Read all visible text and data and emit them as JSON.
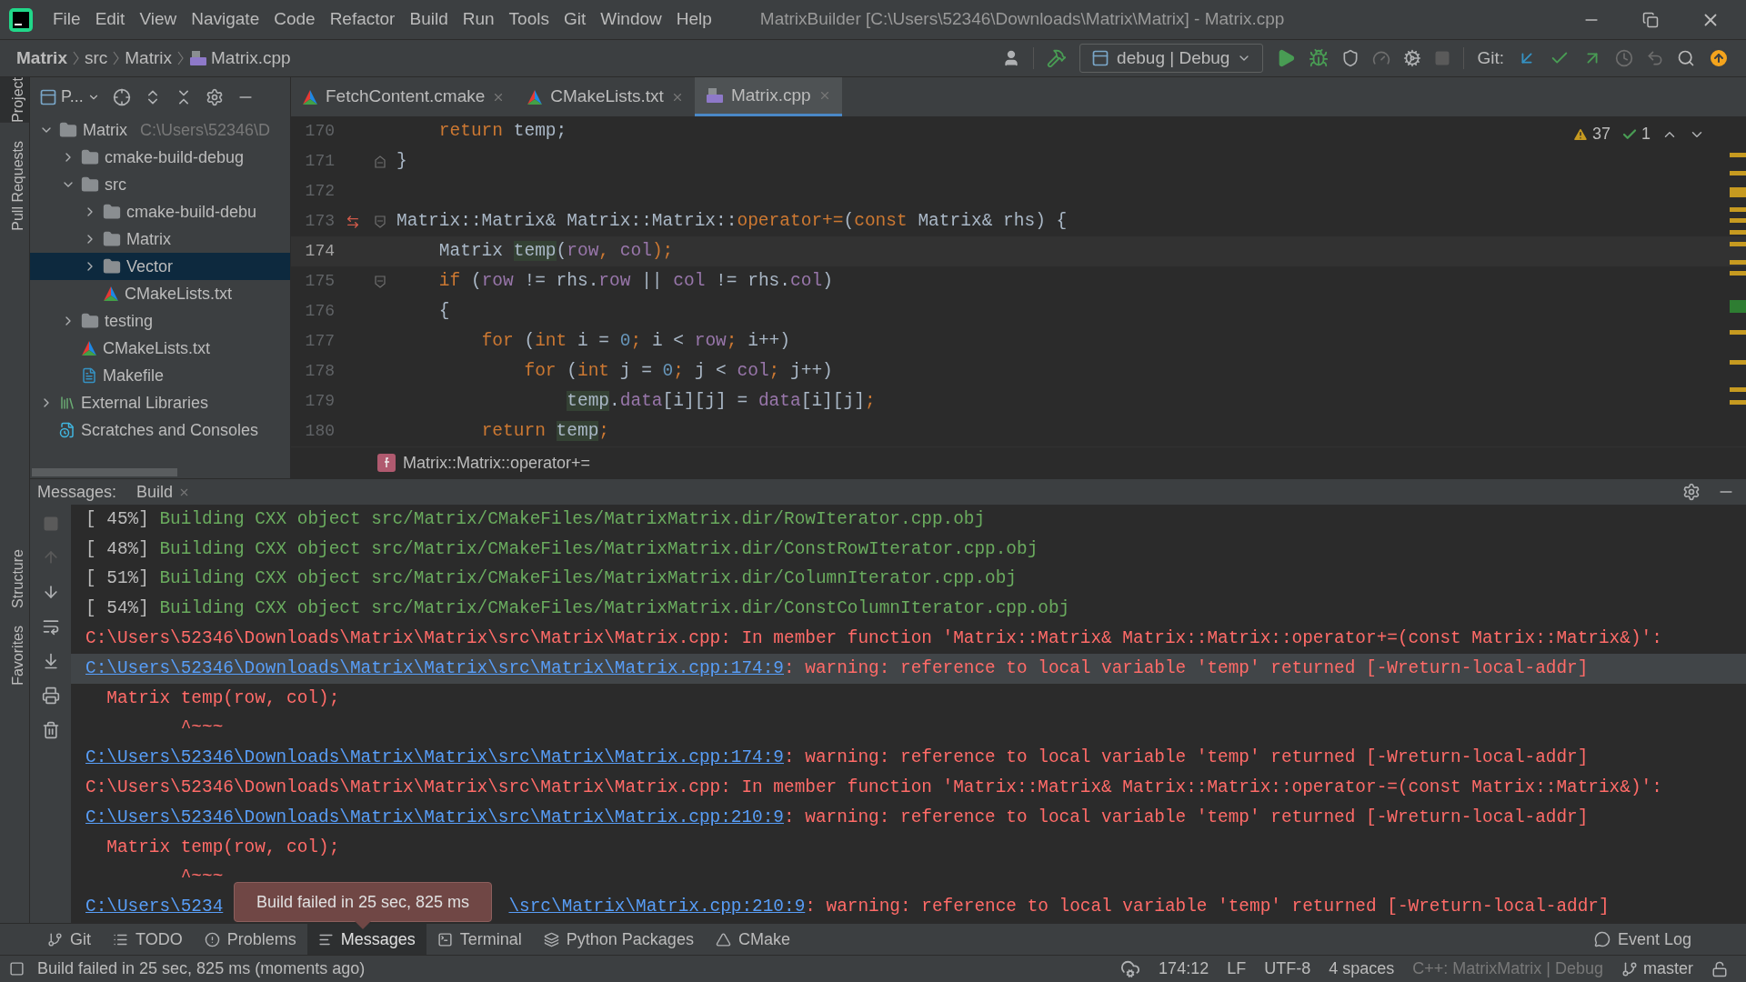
{
  "window": {
    "title": "MatrixBuilder [C:\\Users\\52346\\Downloads\\Matrix\\Matrix] - Matrix.cpp"
  },
  "menu": [
    "File",
    "Edit",
    "View",
    "Navigate",
    "Code",
    "Refactor",
    "Build",
    "Run",
    "Tools",
    "Git",
    "Window",
    "Help"
  ],
  "breadcrumb": [
    "Matrix",
    "src",
    "Matrix",
    "Matrix.cpp"
  ],
  "toolbar": {
    "configuration": "debug | Debug",
    "git_label": "Git:"
  },
  "side_tools": [
    {
      "label": "Project",
      "selected": true
    },
    {
      "label": "Pull Requests",
      "selected": false
    },
    {
      "label": "Structure",
      "selected": false
    },
    {
      "label": "Favorites",
      "selected": false
    }
  ],
  "project": {
    "title": "P...",
    "tree": [
      {
        "kind": "folder",
        "label": "Matrix",
        "path": "C:\\Users\\52346\\D",
        "expanded": true,
        "selected": false,
        "children": [
          {
            "kind": "folder",
            "label": "cmake-build-debug",
            "expanded": false,
            "selected": false
          },
          {
            "kind": "folder",
            "label": "src",
            "expanded": true,
            "selected": false,
            "children": [
              {
                "kind": "folder",
                "label": "cmake-build-debu",
                "expanded": false,
                "selected": false
              },
              {
                "kind": "folder",
                "label": "Matrix",
                "expanded": false,
                "selected": false
              },
              {
                "kind": "folder",
                "label": "Vector",
                "expanded": false,
                "selected": true
              },
              {
                "kind": "cmake",
                "label": "CMakeLists.txt",
                "selected": false
              }
            ]
          },
          {
            "kind": "folder",
            "label": "testing",
            "expanded": false,
            "selected": false
          },
          {
            "kind": "cmake",
            "label": "CMakeLists.txt",
            "selected": false
          },
          {
            "kind": "makefile",
            "label": "Makefile",
            "selected": false
          }
        ]
      },
      {
        "kind": "libraries",
        "label": "External Libraries",
        "expanded": false,
        "selected": false
      },
      {
        "kind": "scratches",
        "label": "Scratches and Consoles",
        "selected": false
      }
    ]
  },
  "editor_tabs": [
    {
      "kind": "cmake",
      "label": "FetchContent.cmake",
      "selected": false
    },
    {
      "kind": "cmake",
      "label": "CMakeLists.txt",
      "selected": false
    },
    {
      "kind": "cpp",
      "label": "Matrix.cpp",
      "selected": true
    }
  ],
  "inspections": {
    "warnings": "37",
    "typos": "1"
  },
  "code": [
    {
      "number": "170",
      "current": false,
      "override": false,
      "fold_start": false,
      "fold_end": false,
      "tokens": [
        {
          "kind": "kw",
          "text": "    return"
        },
        {
          "kind": "plain",
          "text": " temp;"
        }
      ]
    },
    {
      "number": "171",
      "current": false,
      "override": false,
      "fold_start": false,
      "fold_end": true,
      "tokens": [
        {
          "kind": "plain",
          "text": "}"
        }
      ]
    },
    {
      "number": "172",
      "current": false,
      "override": false,
      "fold_start": false,
      "fold_end": false
    },
    {
      "number": "173",
      "current": false,
      "override": true,
      "fold_start": true,
      "fold_end": false,
      "tokens": [
        {
          "kind": "plain",
          "text": "Matrix::Matrix& Matrix::Matrix::"
        },
        {
          "kind": "kw",
          "text": "operator+="
        },
        {
          "kind": "plain",
          "text": "("
        },
        {
          "kind": "kw",
          "text": "const"
        },
        {
          "kind": "plain",
          "text": " Matrix& rhs) {"
        }
      ]
    },
    {
      "number": "174",
      "current": true,
      "override": false,
      "fold_start": false,
      "fold_end": false,
      "tokens": [
        {
          "kind": "plain",
          "text": "    Matrix "
        },
        {
          "kind": "usage",
          "text": "temp"
        },
        {
          "kind": "plain",
          "text": "("
        },
        {
          "kind": "field",
          "text": "row"
        },
        {
          "kind": "kw",
          "text": ", "
        },
        {
          "kind": "field",
          "text": "col"
        },
        {
          "kind": "kw",
          "text": ");"
        }
      ]
    },
    {
      "number": "175",
      "current": false,
      "override": false,
      "fold_start": true,
      "fold_end": false,
      "tokens": [
        {
          "kind": "kw",
          "text": "    if"
        },
        {
          "kind": "plain",
          "text": " ("
        },
        {
          "kind": "field",
          "text": "row"
        },
        {
          "kind": "plain",
          "text": " != rhs."
        },
        {
          "kind": "field",
          "text": "row"
        },
        {
          "kind": "plain",
          "text": " || "
        },
        {
          "kind": "field",
          "text": "col"
        },
        {
          "kind": "plain",
          "text": " != rhs."
        },
        {
          "kind": "field",
          "text": "col"
        },
        {
          "kind": "plain",
          "text": ")"
        }
      ]
    },
    {
      "number": "176",
      "current": false,
      "override": false,
      "fold_start": false,
      "fold_end": false,
      "tokens": [
        {
          "kind": "plain",
          "text": "    {"
        }
      ]
    },
    {
      "number": "177",
      "current": false,
      "override": false,
      "fold_start": false,
      "fold_end": false,
      "tokens": [
        {
          "kind": "kw",
          "text": "        for"
        },
        {
          "kind": "plain",
          "text": " ("
        },
        {
          "kind": "kw",
          "text": "int"
        },
        {
          "kind": "plain",
          "text": " i = "
        },
        {
          "kind": "num",
          "text": "0"
        },
        {
          "kind": "kw",
          "text": ";"
        },
        {
          "kind": "plain",
          "text": " i < "
        },
        {
          "kind": "field",
          "text": "row"
        },
        {
          "kind": "kw",
          "text": ";"
        },
        {
          "kind": "plain",
          "text": " i++)"
        }
      ]
    },
    {
      "number": "178",
      "current": false,
      "override": false,
      "fold_start": false,
      "fold_end": false,
      "tokens": [
        {
          "kind": "kw",
          "text": "            for"
        },
        {
          "kind": "plain",
          "text": " ("
        },
        {
          "kind": "kw",
          "text": "int"
        },
        {
          "kind": "plain",
          "text": " j = "
        },
        {
          "kind": "num",
          "text": "0"
        },
        {
          "kind": "kw",
          "text": ";"
        },
        {
          "kind": "plain",
          "text": " j < "
        },
        {
          "kind": "field",
          "text": "col"
        },
        {
          "kind": "kw",
          "text": ";"
        },
        {
          "kind": "plain",
          "text": " j++)"
        }
      ]
    },
    {
      "number": "179",
      "current": false,
      "override": false,
      "fold_start": false,
      "fold_end": false,
      "tokens": [
        {
          "kind": "usage",
          "text": "                temp"
        },
        {
          "kind": "plain",
          "text": "."
        },
        {
          "kind": "field",
          "text": "data"
        },
        {
          "kind": "plain",
          "text": "[i][j] = "
        },
        {
          "kind": "field",
          "text": "data"
        },
        {
          "kind": "plain",
          "text": "[i][j]"
        },
        {
          "kind": "kw",
          "text": ";"
        }
      ]
    },
    {
      "number": "180",
      "current": false,
      "override": false,
      "fold_start": false,
      "fold_end": false,
      "tokens": [
        {
          "kind": "kw",
          "text": "        return "
        },
        {
          "kind": "usage",
          "text": "temp"
        },
        {
          "kind": "kw",
          "text": ";"
        }
      ]
    }
  ],
  "function_breadcrumb": "Matrix::Matrix::operator+=",
  "messages_panel": {
    "label": "Messages:",
    "tab": "Build",
    "lines": [
      {
        "kind": "progress",
        "percent": "[ 45%]",
        "text": "Building CXX object src/Matrix/CMakeFiles/MatrixMatrix.dir/RowIterator.cpp.obj",
        "selected": false
      },
      {
        "kind": "progress",
        "percent": "[ 48%]",
        "text": "Building CXX object src/Matrix/CMakeFiles/MatrixMatrix.dir/ConstRowIterator.cpp.obj",
        "selected": false
      },
      {
        "kind": "progress",
        "percent": "[ 51%]",
        "text": "Building CXX object src/Matrix/CMakeFiles/MatrixMatrix.dir/ColumnIterator.cpp.obj",
        "selected": false
      },
      {
        "kind": "progress",
        "percent": "[ 54%]",
        "text": "Building CXX object src/Matrix/CMakeFiles/MatrixMatrix.dir/ConstColumnIterator.cpp.obj",
        "selected": false
      },
      {
        "kind": "error",
        "text": "C:\\Users\\52346\\Downloads\\Matrix\\Matrix\\src\\Matrix\\Matrix.cpp: In member function 'Matrix::Matrix& Matrix::Matrix::operator+=(const Matrix::Matrix&)':",
        "selected": false
      },
      {
        "kind": "link",
        "link": "C:\\Users\\52346\\Downloads\\Matrix\\Matrix\\src\\Matrix\\Matrix.cpp:174:9",
        "text": ": warning: reference to local variable 'temp' returned [-Wreturn-local-addr]",
        "selected": true
      },
      {
        "kind": "error",
        "text": "  Matrix temp(row, col);",
        "selected": false
      },
      {
        "kind": "error",
        "text": "         ^~~~",
        "selected": false
      },
      {
        "kind": "link",
        "link": "C:\\Users\\52346\\Downloads\\Matrix\\Matrix\\src\\Matrix\\Matrix.cpp:174:9",
        "text": ": warning: reference to local variable 'temp' returned [-Wreturn-local-addr]",
        "selected": false
      },
      {
        "kind": "error",
        "text": "C:\\Users\\52346\\Downloads\\Matrix\\Matrix\\src\\Matrix\\Matrix.cpp: In member function 'Matrix::Matrix& Matrix::Matrix::operator-=(const Matrix::Matrix&)':",
        "selected": false
      },
      {
        "kind": "link",
        "link": "C:\\Users\\52346\\Downloads\\Matrix\\Matrix\\src\\Matrix\\Matrix.cpp:210:9",
        "text": ": warning: reference to local variable 'temp' returned [-Wreturn-local-addr]",
        "selected": false
      },
      {
        "kind": "error",
        "text": "  Matrix temp(row, col);",
        "selected": false
      },
      {
        "kind": "error",
        "text": "         ^~~~",
        "selected": false
      },
      {
        "kind": "split_link",
        "link": "C:\\Users\\5234",
        "link_end": "\\src\\Matrix\\Matrix.cpp:210:9",
        "text": ": warning: reference to local variable 'temp' returned [-Wreturn-local-addr]",
        "selected": false
      }
    ]
  },
  "tooltip": "Build failed in 25 sec, 825 ms",
  "tool_tabs": [
    {
      "label": "Git",
      "selected": false
    },
    {
      "label": "TODO",
      "selected": false
    },
    {
      "label": "Problems",
      "selected": false
    },
    {
      "label": "Messages",
      "selected": true
    },
    {
      "label": "Terminal",
      "selected": false
    },
    {
      "label": "Python Packages",
      "selected": false
    },
    {
      "label": "CMake",
      "selected": false
    }
  ],
  "event_log": "Event Log",
  "status_bar": {
    "message": "Build failed in 25 sec, 825 ms (moments ago)",
    "position": "174:12",
    "line_separator": "LF",
    "encoding": "UTF-8",
    "indent": "4 spaces",
    "context": "C++: MatrixMatrix | Debug",
    "branch": "master"
  }
}
